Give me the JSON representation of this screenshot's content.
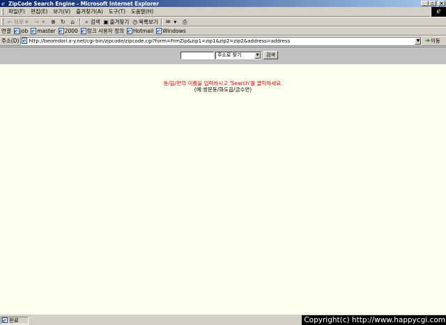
{
  "window": {
    "title": "ZipCode Search Engine - Microsoft Internet Explorer",
    "buttons": {
      "minimize": "_",
      "maximize": "▫",
      "close": "×"
    }
  },
  "menu": [
    "파일(F)",
    "편집(E)",
    "보기(V)",
    "즐겨찾기(A)",
    "도구(T)",
    "도움말(H)"
  ],
  "toolbar": {
    "back": "뒤로",
    "search": "검색",
    "favorites": "즐겨찾기",
    "history": "목록보기"
  },
  "links": {
    "label": "연결",
    "items": [
      "job",
      "master",
      "2000",
      "링크 사용자 정의",
      "Hotmail",
      "Windows"
    ]
  },
  "address": {
    "label": "주소(D)",
    "url": "http://beomdori.x-y.net/cgi-bin/zipcode/zipcode.cgi?form=FrmZip&zip1=zip1&zip2=zip2&address=address",
    "go": "이동"
  },
  "search": {
    "input_value": "",
    "select_value": "주소로 찾기",
    "button": "검색"
  },
  "messages": {
    "instruction": "동/읍/면의 이름을 입력하시고 'Search'를 클릭하세요.",
    "example": "(예:쌍문동/화도읍/금수면)"
  },
  "status": {
    "text": "완료",
    "copyright": "Copyright(c) http://www.happycgi.com"
  }
}
